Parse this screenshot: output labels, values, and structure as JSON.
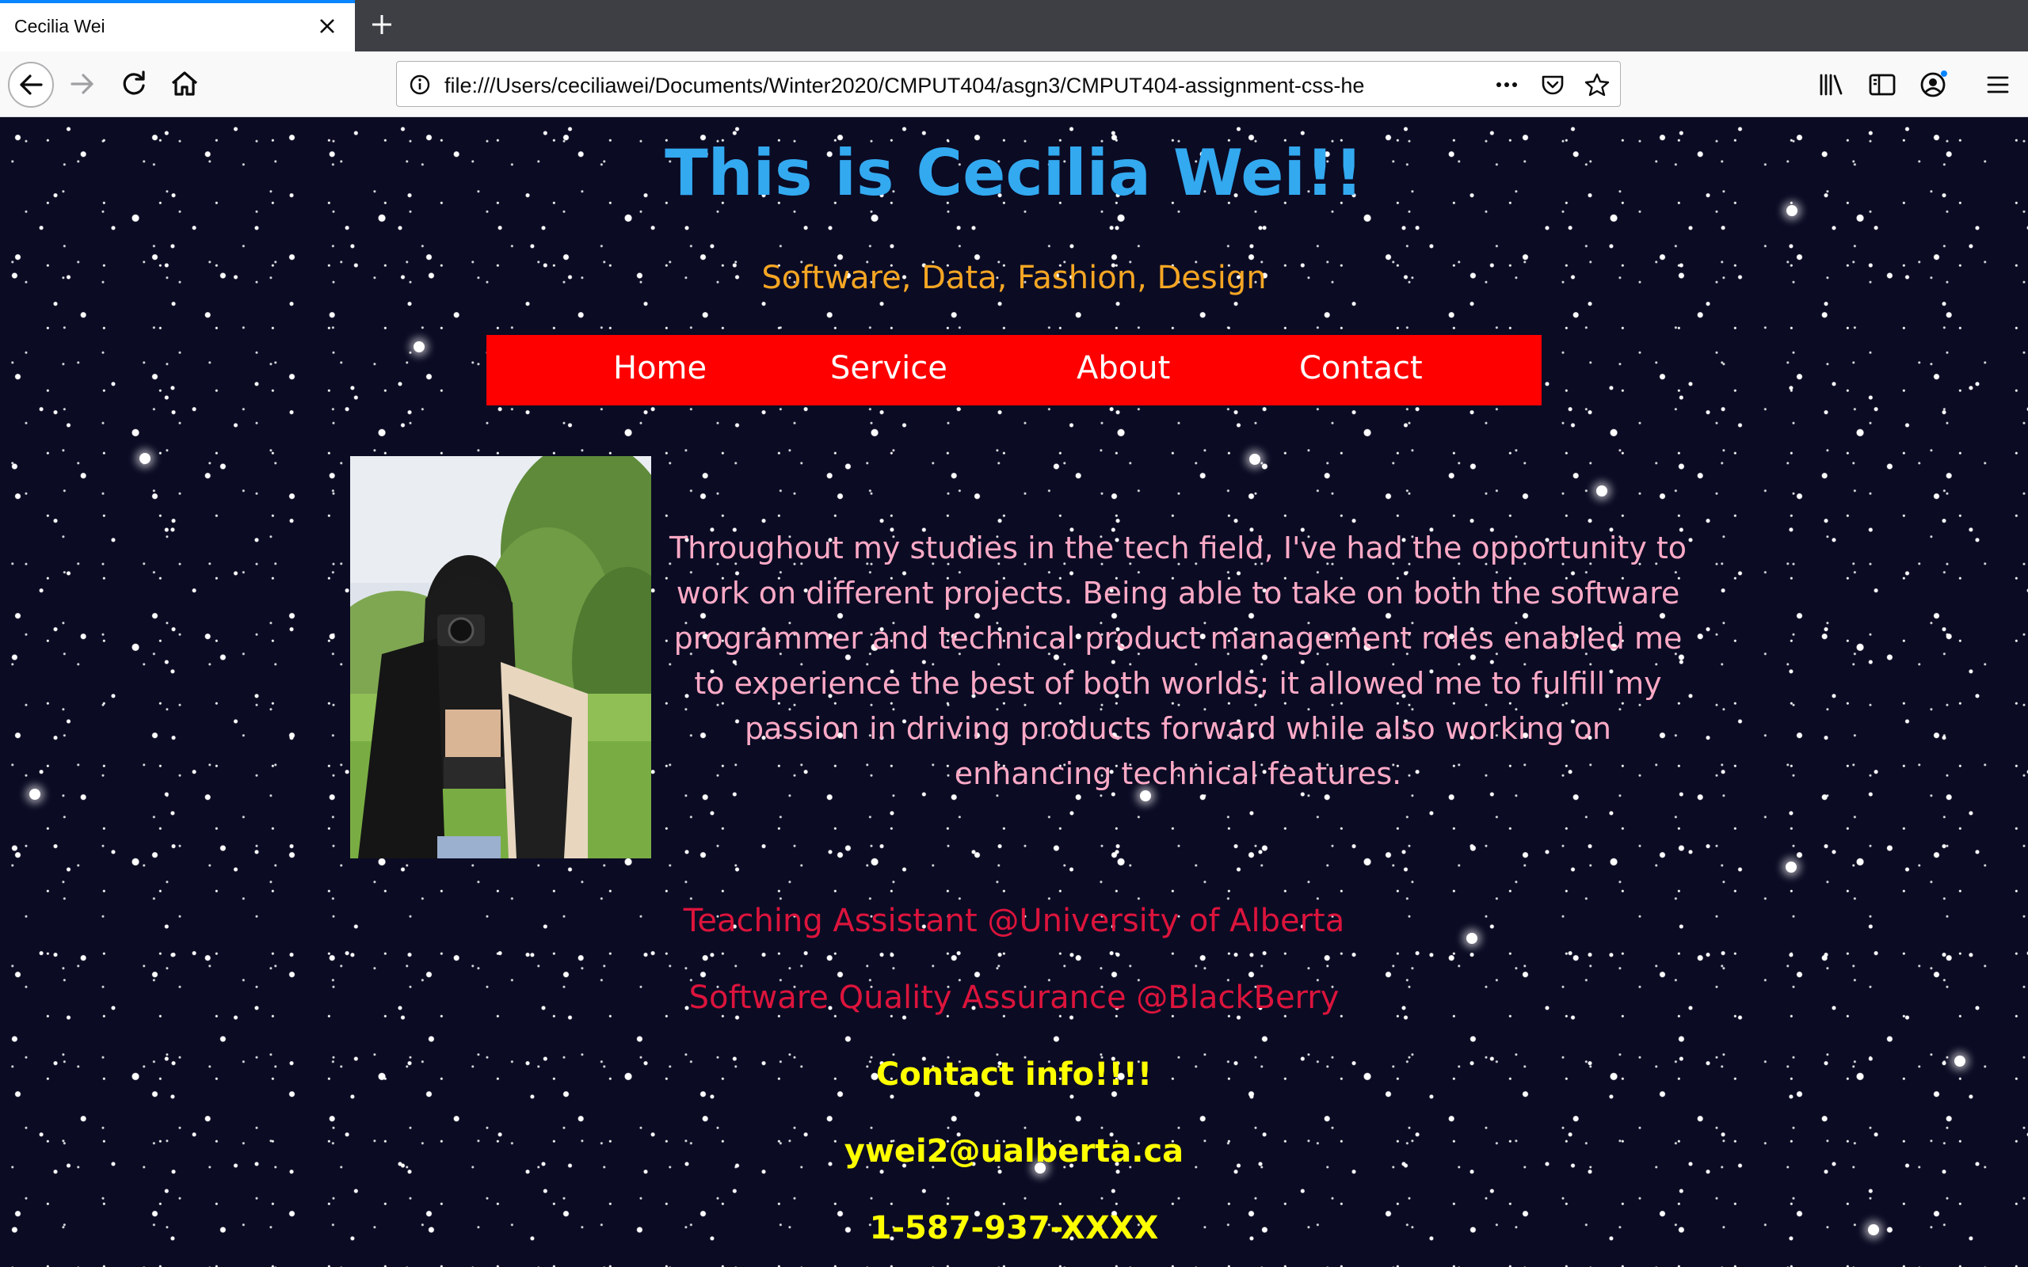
{
  "browser": {
    "tab_title": "Cecilia Wei",
    "url": "file:///Users/ceciliawei/Documents/Winter2020/CMPUT404/asgn3/CMPUT404-assignment-css-he",
    "icons": [
      "back-icon",
      "forward-icon",
      "reload-icon",
      "home-icon",
      "info-icon",
      "more-icon",
      "pocket-icon",
      "bookmark-star-icon",
      "library-icon",
      "sidebar-icon",
      "account-icon",
      "menu-icon",
      "close-icon",
      "plus-icon"
    ],
    "accent_color": "#0a84ff"
  },
  "page": {
    "title": "This is Cecilia Wei!!",
    "subtitle": "Software, Data, Fashion, Design",
    "nav": [
      {
        "label": "Home"
      },
      {
        "label": "Service"
      },
      {
        "label": "About"
      },
      {
        "label": "Contact"
      }
    ],
    "about_text": "Throughout my studies in the tech field, I've had the opportunity to work on different projects. Being able to take on both the software programmer and technical product management roles enabled me to experience the best of both worlds; it allowed me to fulfill my passion in driving products forward while also working on enhancing technical features.",
    "experience": [
      "Teaching Assistant @University of Alberta",
      "Software Quality Assurance @BlackBerry"
    ],
    "contact_heading": "Contact info!!!!",
    "email": "ywei2@ualberta.ca",
    "phone": "1-587-937-XXXX",
    "colors": {
      "title": "#33a9f0",
      "subtitle": "#f5a623",
      "nav_bg": "#ff0000",
      "about": "#ffaac6",
      "experience": "#dc143c",
      "contact": "#ffff00",
      "background": "#0b0b24"
    }
  }
}
